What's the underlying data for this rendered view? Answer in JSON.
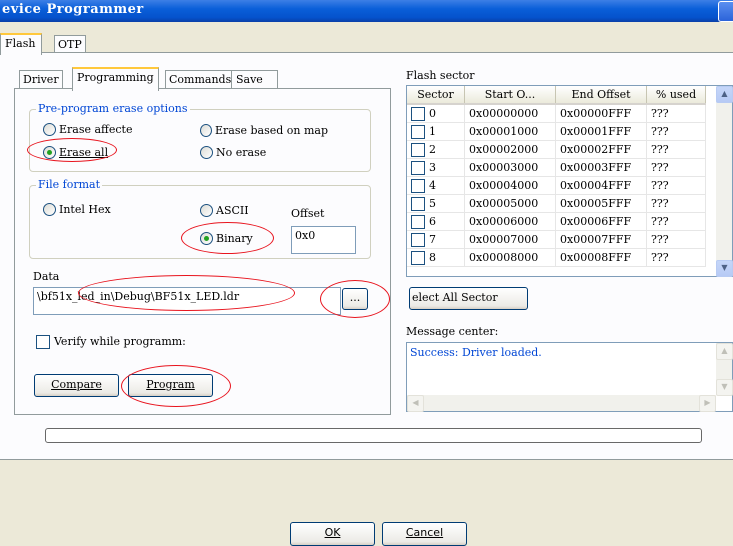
{
  "window": {
    "title": "evice Programmer"
  },
  "tabs_top": [
    "Flash",
    "OTP"
  ],
  "tabs_inner": [
    "Driver",
    "Programming",
    "Commands",
    "Save"
  ],
  "erase": {
    "legend": "Pre-program erase options",
    "opt1": "Erase affecte",
    "opt2": "Erase based on map",
    "opt3": "Erase all",
    "opt4": "No erase"
  },
  "format": {
    "legend": "File format",
    "opt1": "Intel Hex",
    "opt2": "ASCII",
    "opt3": "Binary",
    "offset_label": "Offset",
    "offset_value": "0x0"
  },
  "data": {
    "label": "Data",
    "path": "\\bf51x_led_in\\Debug\\BF51x_LED.ldr",
    "browse": "..."
  },
  "verify_label": "Verify while programm:",
  "buttons": {
    "compare": "Compare",
    "program": "Program",
    "select_all": "elect All Sector",
    "ok": "OK",
    "cancel": "Cancel"
  },
  "flash_sector": {
    "label": "Flash sector",
    "columns": [
      "Sector",
      "Start O...",
      "End Offset",
      "% used"
    ],
    "rows": [
      [
        "0",
        "0x00000000",
        "0x00000FFF",
        "???"
      ],
      [
        "1",
        "0x00001000",
        "0x00001FFF",
        "???"
      ],
      [
        "2",
        "0x00002000",
        "0x00002FFF",
        "???"
      ],
      [
        "3",
        "0x00003000",
        "0x00003FFF",
        "???"
      ],
      [
        "4",
        "0x00004000",
        "0x00004FFF",
        "???"
      ],
      [
        "5",
        "0x00005000",
        "0x00005FFF",
        "???"
      ],
      [
        "6",
        "0x00006000",
        "0x00006FFF",
        "???"
      ],
      [
        "7",
        "0x00007000",
        "0x00007FFF",
        "???"
      ],
      [
        "8",
        "0x00008000",
        "0x00008FFF",
        "???"
      ]
    ]
  },
  "message": {
    "label": "Message center:",
    "text": "Success: Driver loaded."
  },
  "progress": 0,
  "colors": {
    "title_blue": "#0a5fd9",
    "legend_blue": "#0046d5",
    "annotation_red": "#e8141e"
  }
}
